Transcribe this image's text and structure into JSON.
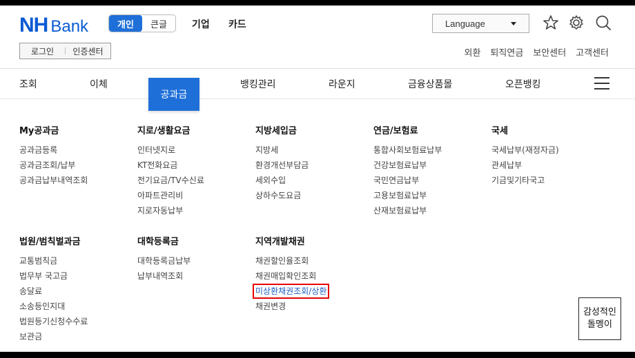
{
  "brand": {
    "nh": "NH",
    "bank": "Bank",
    "color": "#0a5bd3"
  },
  "segment": {
    "personal": "개인",
    "bigtext": "큰글"
  },
  "business_links": {
    "corporate": "기업",
    "card": "카드"
  },
  "auth": {
    "login": "로그인",
    "cert_center": "인증센터"
  },
  "language": {
    "value": "Language"
  },
  "icons": {
    "favorite": "star-icon",
    "settings": "gear-icon",
    "search": "search-icon",
    "menu": "hamburger-icon"
  },
  "util_links": [
    "외환",
    "퇴직연금",
    "보안센터",
    "고객센터"
  ],
  "gnb": [
    "조회",
    "이체",
    "공과금",
    "뱅킹관리",
    "라운지",
    "금융상품몰",
    "오픈뱅킹"
  ],
  "accent_color": "#1f6fd9",
  "highlight_color": "#e60000",
  "menu_sections": [
    {
      "title": "My공과금",
      "items": [
        "공과금등록",
        "공과금조회/납부",
        "공과금납부내역조회"
      ]
    },
    {
      "title": "지로/생활요금",
      "items": [
        "인터넷지로",
        "KT전화요금",
        "전기요금/TV수신료",
        "아파트관리비",
        "지로자동납부"
      ]
    },
    {
      "title": "지방세입금",
      "items": [
        "지방세",
        "환경개선부담금",
        "세외수입",
        "상하수도요금"
      ]
    },
    {
      "title": "연금/보험료",
      "items": [
        "통합사회보험료납부",
        "건강보험료납부",
        "국민연금납부",
        "고용보험료납부",
        "산재보험료납부"
      ]
    },
    {
      "title": "국세",
      "items": [
        "국세납부(재정자금)",
        "관세납부",
        "기금및기타국고"
      ]
    },
    {
      "title": "법원/범칙벌과금",
      "items": [
        "교통범칙금",
        "법무부 국고금",
        "송달료",
        "소송등인지대",
        "법원등기신청수수료",
        "보관금"
      ]
    },
    {
      "title": "대학등록금",
      "items": [
        "대학등록금납부",
        "납부내역조회"
      ]
    },
    {
      "title": "지역개발채권",
      "items": [
        "채권할인율조회",
        "채권매입확인조회",
        "미상환채권조회/상환",
        "채권변경"
      ]
    }
  ],
  "float_badge": {
    "line1": "감성적인",
    "line2": "돌멩이"
  }
}
